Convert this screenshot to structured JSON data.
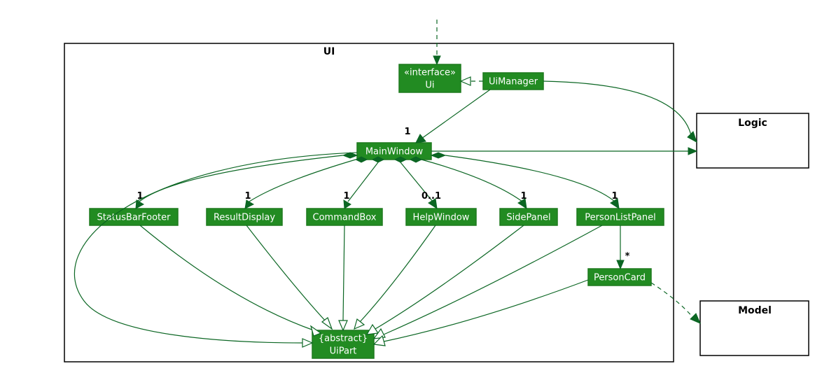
{
  "packages": {
    "ui": {
      "label": "UI"
    },
    "logic": {
      "label": "Logic"
    },
    "model": {
      "label": "Model"
    }
  },
  "nodes": {
    "ui_iface": {
      "stereotype": "«interface»",
      "name": "Ui"
    },
    "uiManager": {
      "name": "UiManager"
    },
    "mainWindow": {
      "name": "MainWindow"
    },
    "statusBarFooter": {
      "name": "StatusBarFooter"
    },
    "resultDisplay": {
      "name": "ResultDisplay"
    },
    "commandBox": {
      "name": "CommandBox"
    },
    "helpWindow": {
      "name": "HelpWindow"
    },
    "sidePanel": {
      "name": "SidePanel"
    },
    "personListPanel": {
      "name": "PersonListPanel"
    },
    "personCard": {
      "name": "PersonCard"
    },
    "uiPart": {
      "stereotype": "{abstract}",
      "name": "UiPart"
    }
  },
  "multiplicities": {
    "mw": "1",
    "sbf": "1",
    "rd": "1",
    "cb": "1",
    "hw": "0..1",
    "sp": "1",
    "plp": "1",
    "pc": "*"
  },
  "chart_data": {
    "type": "uml-class-diagram",
    "packages": [
      {
        "name": "UI",
        "contains": [
          "Ui",
          "UiManager",
          "MainWindow",
          "StatusBarFooter",
          "ResultDisplay",
          "CommandBox",
          "HelpWindow",
          "SidePanel",
          "PersonListPanel",
          "PersonCard",
          "UiPart"
        ]
      },
      {
        "name": "Logic",
        "contains": []
      },
      {
        "name": "Model",
        "contains": []
      }
    ],
    "classes": [
      {
        "name": "Ui",
        "stereotype": "interface"
      },
      {
        "name": "UiManager"
      },
      {
        "name": "MainWindow"
      },
      {
        "name": "StatusBarFooter"
      },
      {
        "name": "ResultDisplay"
      },
      {
        "name": "CommandBox"
      },
      {
        "name": "HelpWindow"
      },
      {
        "name": "SidePanel"
      },
      {
        "name": "PersonListPanel"
      },
      {
        "name": "PersonCard"
      },
      {
        "name": "UiPart",
        "stereotype": "abstract"
      }
    ],
    "relations": [
      {
        "from": "(external)",
        "to": "Ui",
        "type": "dependency"
      },
      {
        "from": "UiManager",
        "to": "Ui",
        "type": "realization"
      },
      {
        "from": "UiManager",
        "to": "MainWindow",
        "type": "association",
        "multiplicity_to": "1"
      },
      {
        "from": "UiManager",
        "to": "Logic",
        "type": "association"
      },
      {
        "from": "MainWindow",
        "to": "Logic",
        "type": "association"
      },
      {
        "from": "MainWindow",
        "to": "StatusBarFooter",
        "type": "composition",
        "multiplicity_to": "1"
      },
      {
        "from": "MainWindow",
        "to": "ResultDisplay",
        "type": "composition",
        "multiplicity_to": "1"
      },
      {
        "from": "MainWindow",
        "to": "CommandBox",
        "type": "composition",
        "multiplicity_to": "1"
      },
      {
        "from": "MainWindow",
        "to": "HelpWindow",
        "type": "composition",
        "multiplicity_to": "0..1"
      },
      {
        "from": "MainWindow",
        "to": "SidePanel",
        "type": "composition",
        "multiplicity_to": "1"
      },
      {
        "from": "MainWindow",
        "to": "PersonListPanel",
        "type": "composition",
        "multiplicity_to": "1"
      },
      {
        "from": "PersonListPanel",
        "to": "PersonCard",
        "type": "association",
        "multiplicity_to": "*"
      },
      {
        "from": "MainWindow",
        "to": "UiPart",
        "type": "generalization"
      },
      {
        "from": "StatusBarFooter",
        "to": "UiPart",
        "type": "generalization"
      },
      {
        "from": "ResultDisplay",
        "to": "UiPart",
        "type": "generalization"
      },
      {
        "from": "CommandBox",
        "to": "UiPart",
        "type": "generalization"
      },
      {
        "from": "HelpWindow",
        "to": "UiPart",
        "type": "generalization"
      },
      {
        "from": "SidePanel",
        "to": "UiPart",
        "type": "generalization"
      },
      {
        "from": "PersonListPanel",
        "to": "UiPart",
        "type": "generalization"
      },
      {
        "from": "PersonCard",
        "to": "UiPart",
        "type": "generalization"
      },
      {
        "from": "PersonCard",
        "to": "Model",
        "type": "dependency"
      }
    ]
  }
}
